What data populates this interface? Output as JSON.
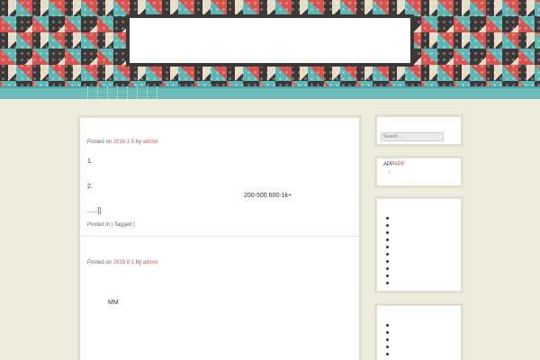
{
  "header": {
    "site_title": ""
  },
  "posts": [
    {
      "meta_prefix": "Posted on",
      "date": "2016  1  5",
      "by": "by",
      "author": "admin",
      "line1": "1.",
      "line2": "2.",
      "line2_right": "200-500   600-1k+",
      "more": "......[]",
      "footer": "Posted in  | Tagged  |"
    },
    {
      "meta_prefix": "Posted on",
      "date": "2015  9  1",
      "by": "by",
      "author": "admin",
      "body": "MM"
    }
  ],
  "sidebar": {
    "search_placeholder": "Search ...",
    "app_widget": {
      "app1": "APP",
      "app2": "APP",
      "colors": {
        "red": "#d9544f",
        "blue": "#3a6ea5"
      }
    }
  },
  "colors": {
    "accent": "#d9544f",
    "teal": "#6cbcb8",
    "background": "#edeade"
  }
}
